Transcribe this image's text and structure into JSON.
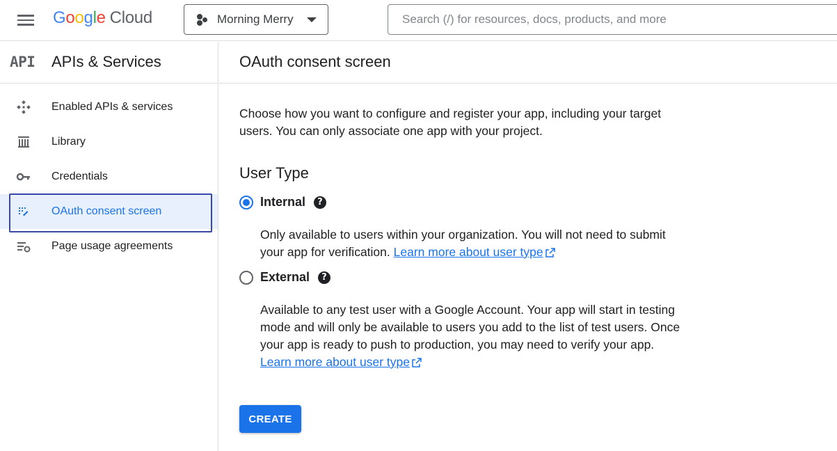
{
  "topbar": {
    "logo_google": "Google",
    "logo_cloud": "Cloud",
    "project_name": "Morning Merry",
    "search_placeholder": "Search (/) for resources, docs, products, and more"
  },
  "sidebar": {
    "api_badge": "API",
    "title": "APIs & Services",
    "items": [
      {
        "label": "Enabled APIs & services",
        "icon": "enabled-apis-icon"
      },
      {
        "label": "Library",
        "icon": "library-icon"
      },
      {
        "label": "Credentials",
        "icon": "key-icon"
      },
      {
        "label": "OAuth consent screen",
        "icon": "oauth-consent-icon",
        "active": true
      },
      {
        "label": "Page usage agreements",
        "icon": "settings-list-icon"
      }
    ]
  },
  "main": {
    "title": "OAuth consent screen",
    "intro": "Choose how you want to configure and register your app, including your target users. You can only associate one app with your project.",
    "user_type_heading": "User Type",
    "options": [
      {
        "label": "Internal",
        "selected": true,
        "description": "Only available to users within your organization. You will not need to submit your app for verification.",
        "link": "Learn more about user type"
      },
      {
        "label": "External",
        "selected": false,
        "description": "Available to any test user with a Google Account. Your app will start in testing mode and will only be available to users you add to the list of test users. Once your app is ready to push to production, you may need to verify your app.",
        "link": "Learn more about user type"
      }
    ],
    "create_label": "CREATE"
  },
  "colors": {
    "accent": "#1a73e8",
    "active_nav_bg": "#e8f0fe",
    "focus_outline": "#3949ab"
  }
}
